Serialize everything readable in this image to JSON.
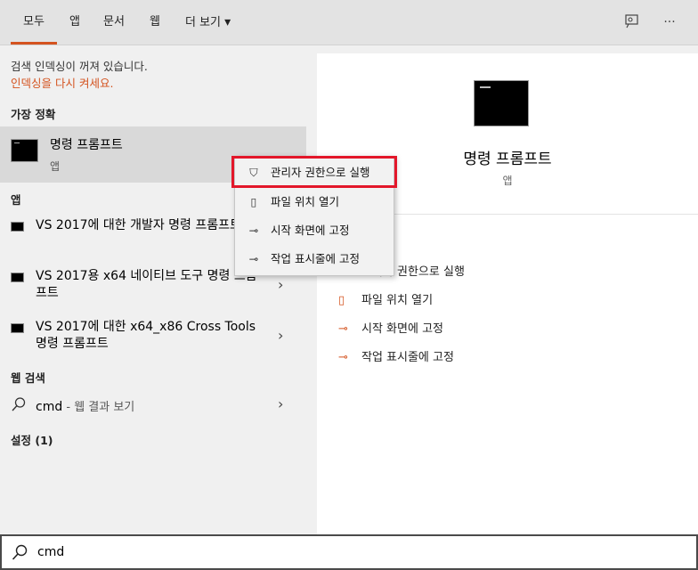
{
  "tabs": [
    {
      "label": "모두",
      "active": true
    },
    {
      "label": "앱"
    },
    {
      "label": "문서"
    },
    {
      "label": "웹"
    },
    {
      "label": "더 보기"
    }
  ],
  "more_arrow": "▾",
  "topbar_icons": [
    "feedback-icon",
    "more-icon"
  ],
  "topbar_more_glyph": "···",
  "hint": {
    "line1": "검색 인덱싱이 꺼져 있습니다.",
    "line2": "인덱싱을 다시 켜세요."
  },
  "sections": {
    "best": "가장 정확",
    "apps": "앱",
    "web": "웹 검색",
    "settings": "설정 (1)"
  },
  "best_match": {
    "title": "명령 프롬프트",
    "subtitle": "앱"
  },
  "app_results": [
    {
      "text": "VS 2017에 대한 개발자 명령 프롬프트"
    },
    {
      "text": "VS 2017용 x64 네이티브 도구 명령 프롬프트"
    },
    {
      "text": "VS 2017에 대한 x64_x86 Cross Tools 명령 프롬프트"
    }
  ],
  "web_search": {
    "query": "cmd",
    "suffix": " - 웹 결과 보기"
  },
  "chevron": "›",
  "preview": {
    "title": "명령 프롬프트",
    "subtitle": "앱",
    "actions": [
      {
        "label": "관리자 권한으로 실행",
        "icon": "shield-icon"
      },
      {
        "label": "파일 위치 열기",
        "icon": "folder-icon"
      },
      {
        "label": "시작 화면에 고정",
        "icon": "pin-icon"
      },
      {
        "label": "작업 표시줄에 고정",
        "icon": "pin-icon"
      }
    ]
  },
  "context_menu": [
    {
      "label": "관리자 권한으로 실행",
      "icon": "shield-icon"
    },
    {
      "label": "파일 위치 열기",
      "icon": "folder-icon"
    },
    {
      "label": "시작 화면에 고정",
      "icon": "pin-icon"
    },
    {
      "label": "작업 표시줄에 고정",
      "icon": "pin-icon"
    }
  ],
  "search": {
    "value": "cmd"
  },
  "colors": {
    "accent": "#d4531f",
    "highlight": "#e3172a"
  }
}
